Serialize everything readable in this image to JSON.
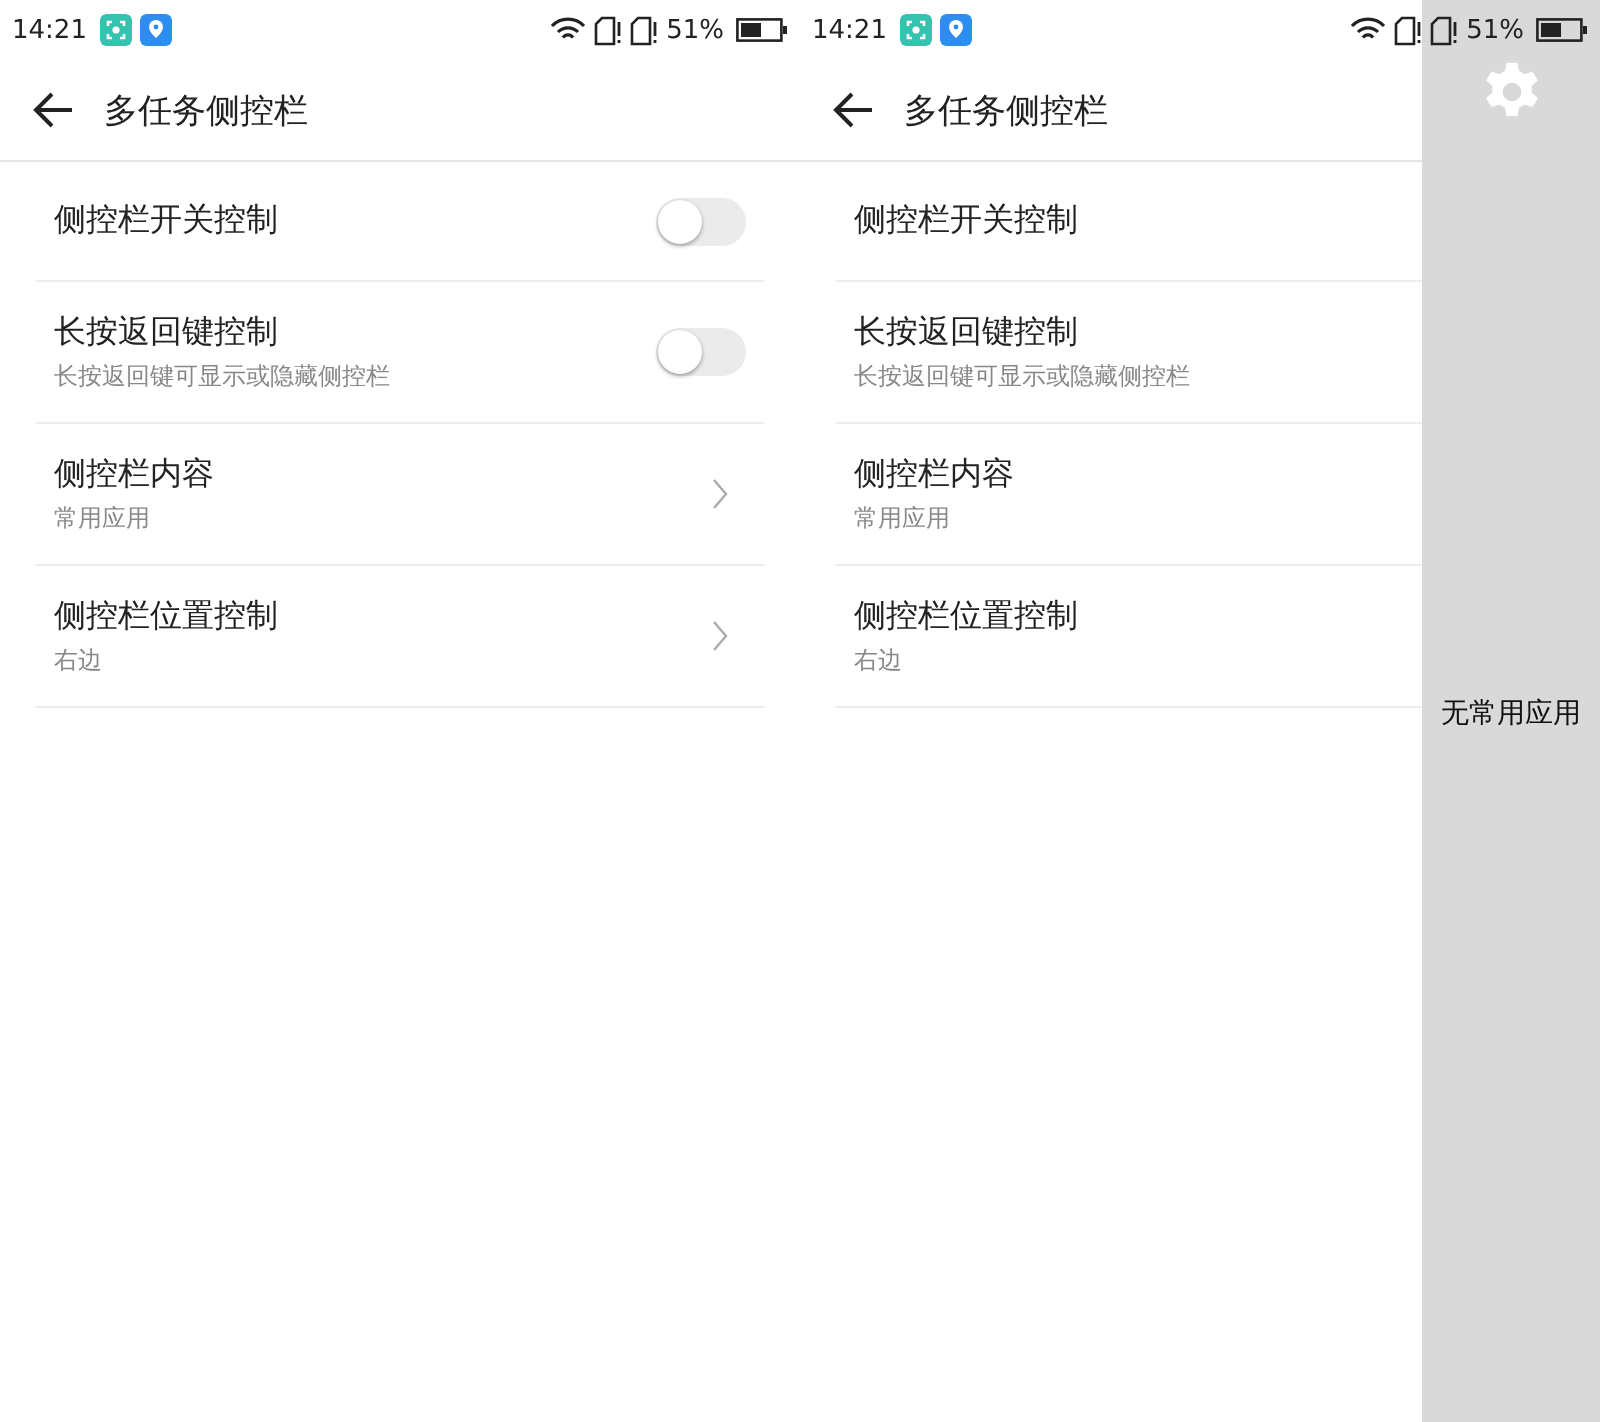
{
  "screens": [
    {
      "status_bar": {
        "time": "14:21",
        "battery": "51%"
      },
      "title": "多任务侧控栏",
      "rows": [
        {
          "kind": "toggle",
          "title": "侧控栏开关控制",
          "on": false
        },
        {
          "kind": "toggle",
          "title": "长按返回键控制",
          "subtitle": "长按返回键可显示或隐藏侧控栏",
          "on": false
        },
        {
          "kind": "link",
          "title": "侧控栏内容",
          "subtitle": "常用应用"
        },
        {
          "kind": "link",
          "title": "侧控栏位置控制",
          "subtitle": "右边"
        }
      ]
    },
    {
      "status_bar": {
        "time": "14:21",
        "battery": "51%"
      },
      "title": "多任务侧控栏",
      "rows": [
        {
          "kind": "text",
          "title": "侧控栏开关控制"
        },
        {
          "kind": "text",
          "title": "长按返回键控制",
          "subtitle": "长按返回键可显示或隐藏侧控栏"
        },
        {
          "kind": "text",
          "title": "侧控栏内容",
          "subtitle": "常用应用"
        },
        {
          "kind": "text",
          "title": "侧控栏位置控制",
          "subtitle": "右边"
        }
      ],
      "side_panel": {
        "empty_text": "无常用应用"
      }
    }
  ]
}
